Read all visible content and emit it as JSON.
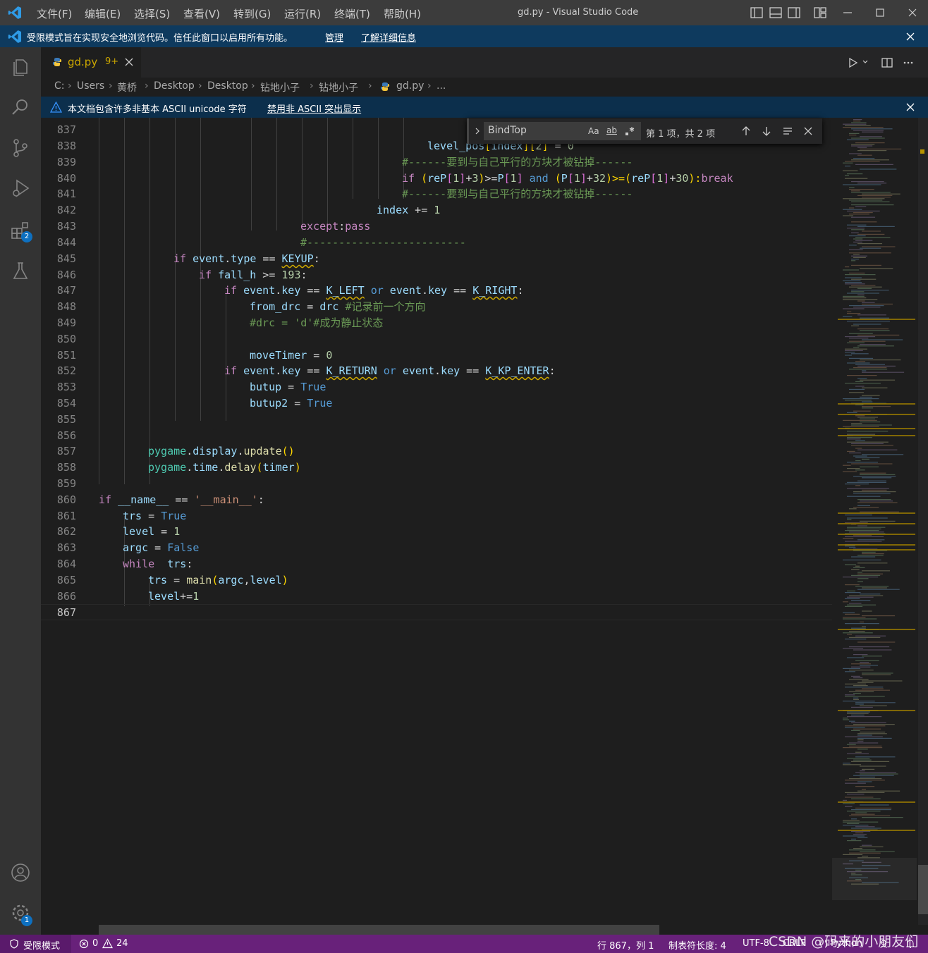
{
  "window": {
    "title": "gd.py - Visual Studio Code",
    "menu": [
      "文件(F)",
      "编辑(E)",
      "选择(S)",
      "查看(V)",
      "转到(G)",
      "运行(R)",
      "终端(T)",
      "帮助(H)"
    ]
  },
  "restricted_banner": {
    "message": "受限模式旨在实现安全地浏览代码。信任此窗口以启用所有功能。",
    "manage": "管理",
    "learn_more": "了解详细信息"
  },
  "tab": {
    "filename": "gd.py",
    "problems": "9+"
  },
  "breadcrumb": [
    "C:",
    "Users",
    "黄桥",
    "Desktop",
    "Desktop",
    "钻地小子",
    "钻地小子",
    "gd.py",
    "..."
  ],
  "unicode_banner": {
    "message": "本文档包含许多非基本 ASCII unicode 字符",
    "action": "禁用非 ASCII 突出显示"
  },
  "find": {
    "query": "BindTop",
    "match_case": "Aa",
    "whole_word": "ab",
    "result": "第 1 项，共 2 项"
  },
  "activity": {
    "extensions_badge": "2",
    "settings_badge": "1"
  },
  "editor": {
    "current_line": "867",
    "lines": [
      {
        "n": "837",
        "indent": 0
      },
      {
        "n": "838",
        "indent": 0
      },
      {
        "n": "839",
        "indent": 0
      },
      {
        "n": "840",
        "indent": 0
      },
      {
        "n": "841",
        "indent": 0
      },
      {
        "n": "842",
        "indent": 0
      },
      {
        "n": "843",
        "indent": 0
      },
      {
        "n": "844",
        "indent": 0
      },
      {
        "n": "845",
        "indent": 0
      },
      {
        "n": "846",
        "indent": 0
      },
      {
        "n": "847",
        "indent": 0
      },
      {
        "n": "848",
        "indent": 0
      },
      {
        "n": "849",
        "indent": 0
      },
      {
        "n": "850",
        "indent": 0
      },
      {
        "n": "851",
        "indent": 0
      },
      {
        "n": "852",
        "indent": 0
      },
      {
        "n": "853",
        "indent": 0
      },
      {
        "n": "854",
        "indent": 0
      },
      {
        "n": "855",
        "indent": 0
      },
      {
        "n": "856",
        "indent": 0
      },
      {
        "n": "857",
        "indent": 0
      },
      {
        "n": "858",
        "indent": 0
      },
      {
        "n": "859",
        "indent": 0
      },
      {
        "n": "860",
        "indent": 0
      },
      {
        "n": "861",
        "indent": 0
      },
      {
        "n": "862",
        "indent": 0
      },
      {
        "n": "863",
        "indent": 0
      },
      {
        "n": "864",
        "indent": 0
      },
      {
        "n": "865",
        "indent": 0
      },
      {
        "n": "866",
        "indent": 0
      },
      {
        "n": "867",
        "indent": 0
      }
    ],
    "code": {
      "l838": [
        "level_pos",
        "[",
        "index",
        "][",
        "2",
        "]",
        " = ",
        "0"
      ],
      "l839": "#------要到与自己平行的方块才被钻掉------",
      "l840": [
        "if",
        " (",
        "reP",
        "[",
        "1",
        "]",
        "+",
        "3",
        ")",
        ">=",
        "P",
        "[",
        "1",
        "]",
        " and",
        " (",
        "P",
        "[",
        "1",
        "]",
        "+",
        "32",
        ")",
        ">=(",
        "reP",
        "[",
        "1",
        "]",
        "+",
        "30",
        "):",
        "break"
      ],
      "l841": "#------要到与自己平行的方块才被钻掉------",
      "l842": [
        "index",
        " += ",
        "1"
      ],
      "l843": [
        "except",
        ":",
        "pass"
      ],
      "l844": "#-------------------------",
      "l845": [
        "if",
        " event",
        ".",
        "type",
        " == ",
        "KEYUP",
        ":"
      ],
      "l846": [
        "if",
        " fall_h",
        " >= ",
        "193",
        ":"
      ],
      "l847": [
        "if",
        " event",
        ".",
        "key",
        " == ",
        "K_LEFT",
        " or",
        " event",
        ".",
        "key",
        " == ",
        "K_RIGHT",
        ":"
      ],
      "l848": [
        "from_drc",
        " = ",
        "drc",
        " #记录前一个方向"
      ],
      "l849": "#drc = 'd'#成为静止状态",
      "l851": [
        "moveTimer",
        " = ",
        "0"
      ],
      "l852": [
        "if",
        " event",
        ".",
        "key",
        " == ",
        "K_RETURN",
        " or",
        " event",
        ".",
        "key",
        " == ",
        "K_KP_ENTER",
        ":"
      ],
      "l853": [
        "butup",
        " = ",
        "True"
      ],
      "l854": [
        "butup2",
        " = ",
        "True"
      ],
      "l857": [
        "pygame",
        ".",
        "display",
        ".",
        "update",
        "()"
      ],
      "l858": [
        "pygame",
        ".",
        "time",
        ".",
        "delay",
        "(",
        "timer",
        ")"
      ],
      "l860": [
        "if",
        " __name__",
        " == ",
        "'__main__'",
        ":"
      ],
      "l861": [
        "trs",
        " = ",
        "True"
      ],
      "l862": [
        "level",
        " = ",
        "1"
      ],
      "l863": [
        "argc",
        " = ",
        "False"
      ],
      "l864": [
        "while",
        "  trs",
        ":"
      ],
      "l865": [
        "trs",
        " = ",
        "main",
        "(",
        "argc",
        ",",
        "level",
        ")"
      ],
      "l866": [
        "level",
        "+=",
        "1"
      ]
    }
  },
  "status": {
    "restricted": "受限模式",
    "errors": "0",
    "warnings": "24",
    "position": "行 867，列 1",
    "tab_size": "制表符长度: 4",
    "encoding": "UTF-8",
    "eol": "CRLF",
    "language": "Python",
    "watermark": "CSDN @码来的小朋友们"
  },
  "colors": {
    "statusbar": "#68217a",
    "banner": "#0e3a5e",
    "accent": "#0e70c0"
  }
}
